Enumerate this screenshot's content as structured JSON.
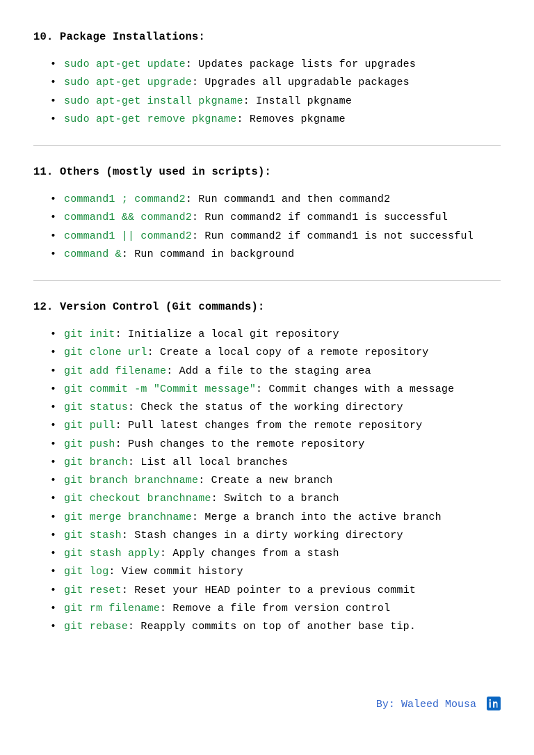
{
  "sections": [
    {
      "title": "10. Package Installations:",
      "items": [
        {
          "cmd": "sudo apt-get update",
          "desc": ": Updates package lists for upgrades"
        },
        {
          "cmd": "sudo apt-get upgrade",
          "desc": ": Upgrades all upgradable packages"
        },
        {
          "cmd": "sudo apt-get install pkgname",
          "desc": ": Install pkgname"
        },
        {
          "cmd": "sudo apt-get remove pkgname",
          "desc": ": Removes pkgname"
        }
      ]
    },
    {
      "title": "11. Others (mostly used in scripts):",
      "items": [
        {
          "cmd": "command1 ; command2",
          "desc": ": Run command1 and then command2"
        },
        {
          "cmd": "command1 && command2",
          "desc": ": Run command2 if command1 is successful"
        },
        {
          "cmd": "command1 || command2",
          "desc": ": Run command2 if command1 is not successful"
        },
        {
          "cmd": "command &",
          "desc": ": Run command in background"
        }
      ]
    },
    {
      "title": "12. Version Control (Git commands):",
      "items": [
        {
          "cmd": "git init",
          "desc": ": Initialize a local git repository"
        },
        {
          "cmd": "git clone url",
          "desc": ": Create a local copy of a remote repository"
        },
        {
          "cmd": "git add filename",
          "desc": ": Add a file to the staging area"
        },
        {
          "cmd": "git commit -m \"Commit message\"",
          "desc": ": Commit changes with a message"
        },
        {
          "cmd": "git status",
          "desc": ": Check the status of the working directory"
        },
        {
          "cmd": "git pull",
          "desc": ": Pull latest changes from the remote repository"
        },
        {
          "cmd": "git push",
          "desc": ": Push changes to the remote repository"
        },
        {
          "cmd": "git branch",
          "desc": ": List all local branches"
        },
        {
          "cmd": "git branch branchname",
          "desc": ": Create a new branch"
        },
        {
          "cmd": "git checkout branchname",
          "desc": ": Switch to a branch"
        },
        {
          "cmd": "git merge branchname",
          "desc": ": Merge a branch into the active branch"
        },
        {
          "cmd": "git stash",
          "desc": ": Stash changes in a dirty working directory"
        },
        {
          "cmd": "git stash apply",
          "desc": ": Apply changes from a stash"
        },
        {
          "cmd": "git log",
          "desc": ": View commit history"
        },
        {
          "cmd": "git reset",
          "desc": ": Reset your HEAD pointer to a previous commit"
        },
        {
          "cmd": "git rm filename",
          "desc": ": Remove a file from version control"
        },
        {
          "cmd": "git rebase",
          "desc": ": Reapply commits on top of another base tip."
        }
      ]
    }
  ],
  "footer": {
    "by": "By:",
    "author": "Waleed Mousa"
  }
}
